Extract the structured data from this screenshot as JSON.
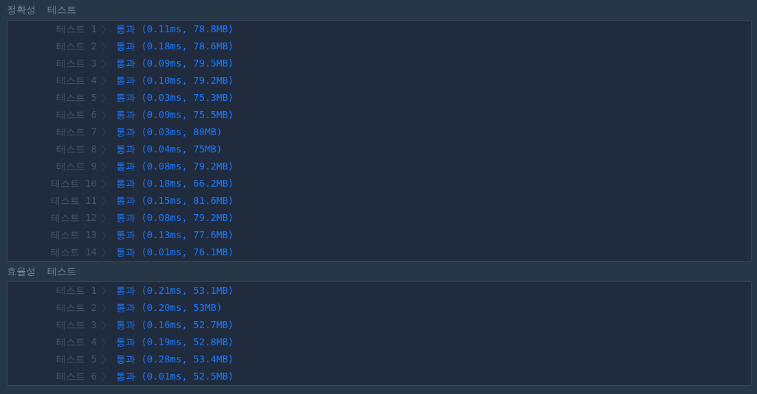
{
  "sections": [
    {
      "title": "정확성",
      "subtitle": "테스트",
      "tests": [
        {
          "label": "테스트 1",
          "result": "통과 (0.11ms, 78.8MB)"
        },
        {
          "label": "테스트 2",
          "result": "통과 (0.18ms, 78.6MB)"
        },
        {
          "label": "테스트 3",
          "result": "통과 (0.09ms, 79.5MB)"
        },
        {
          "label": "테스트 4",
          "result": "통과 (0.10ms, 79.2MB)"
        },
        {
          "label": "테스트 5",
          "result": "통과 (0.03ms, 75.3MB)"
        },
        {
          "label": "테스트 6",
          "result": "통과 (0.09ms, 75.5MB)"
        },
        {
          "label": "테스트 7",
          "result": "통과 (0.03ms, 80MB)"
        },
        {
          "label": "테스트 8",
          "result": "통과 (0.04ms, 75MB)"
        },
        {
          "label": "테스트 9",
          "result": "통과 (0.08ms, 79.2MB)"
        },
        {
          "label": "테스트 10",
          "result": "통과 (0.18ms, 66.2MB)"
        },
        {
          "label": "테스트 11",
          "result": "통과 (0.15ms, 81.6MB)"
        },
        {
          "label": "테스트 12",
          "result": "통과 (0.08ms, 79.2MB)"
        },
        {
          "label": "테스트 13",
          "result": "통과 (0.13ms, 77.6MB)"
        },
        {
          "label": "테스트 14",
          "result": "통과 (0.01ms, 76.1MB)"
        }
      ]
    },
    {
      "title": "효율성",
      "subtitle": "테스트",
      "tests": [
        {
          "label": "테스트 1",
          "result": "통과 (0.21ms, 53.1MB)"
        },
        {
          "label": "테스트 2",
          "result": "통과 (0.20ms, 53MB)"
        },
        {
          "label": "테스트 3",
          "result": "통과 (0.16ms, 52.7MB)"
        },
        {
          "label": "테스트 4",
          "result": "통과 (0.19ms, 52.8MB)"
        },
        {
          "label": "테스트 5",
          "result": "통과 (0.28ms, 53.4MB)"
        },
        {
          "label": "테스트 6",
          "result": "통과 (0.01ms, 52.5MB)"
        }
      ]
    }
  ]
}
